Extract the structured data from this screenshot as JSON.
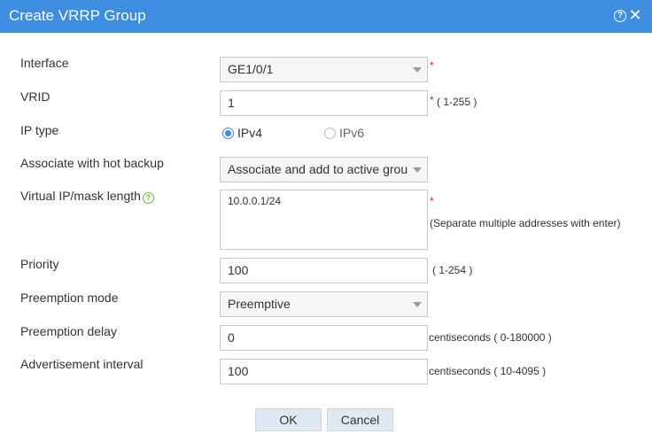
{
  "dialog": {
    "title": "Create VRRP Group"
  },
  "form": {
    "interface": {
      "label": "Interface",
      "value": "GE1/0/1",
      "required_mark": "*"
    },
    "vrid": {
      "label": "VRID",
      "value": "1",
      "required_mark": "*",
      "hint": "( 1-255 )"
    },
    "ip_type": {
      "label": "IP type",
      "options": [
        "IPv4",
        "IPv6"
      ],
      "selected": "IPv4"
    },
    "hot_backup": {
      "label": "Associate with hot backup",
      "value": "Associate and add to active group"
    },
    "virtual_ip": {
      "label": "Virtual IP/mask length",
      "value": "10.0.0.1/24",
      "required_mark": "*",
      "hint": "(Separate multiple addresses with enter)"
    },
    "priority": {
      "label": "Priority",
      "value": "100",
      "hint": "( 1-254 )"
    },
    "preemption_mode": {
      "label": "Preemption mode",
      "value": "Preemptive"
    },
    "preemption_delay": {
      "label": "Preemption delay",
      "value": "0",
      "hint": "centiseconds ( 0-180000 )"
    },
    "adv_interval": {
      "label": "Advertisement interval",
      "value": "100",
      "hint": "centiseconds ( 10-4095 )"
    }
  },
  "buttons": {
    "ok": "OK",
    "cancel": "Cancel"
  },
  "icons": {
    "help": "help-icon",
    "close": "close-icon",
    "info": "question-icon",
    "dropdown": "chevron-down-icon"
  },
  "colors": {
    "titlebar": "#3d8de0",
    "required": "#e02020",
    "info_icon": "#6fbf3a"
  }
}
